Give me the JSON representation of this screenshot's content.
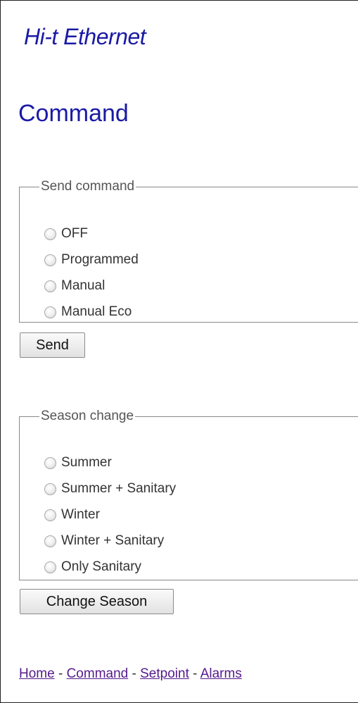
{
  "header": {
    "app_title": "Hi-t Ethernet",
    "page_title": "Command"
  },
  "send_command": {
    "legend": "Send command",
    "options": [
      "OFF",
      "Programmed",
      "Manual",
      "Manual Eco"
    ],
    "button_label": "Send"
  },
  "season_change": {
    "legend": "Season change",
    "options": [
      "Summer",
      "Summer + Sanitary",
      "Winter",
      "Winter + Sanitary",
      "Only Sanitary"
    ],
    "button_label": "Change Season"
  },
  "footer_nav": {
    "links": [
      "Home",
      "Command",
      "Setpoint",
      "Alarms"
    ],
    "separator": " - "
  },
  "colors": {
    "title_blue": "#1a1aa6",
    "visited_link": "#551a8b"
  }
}
